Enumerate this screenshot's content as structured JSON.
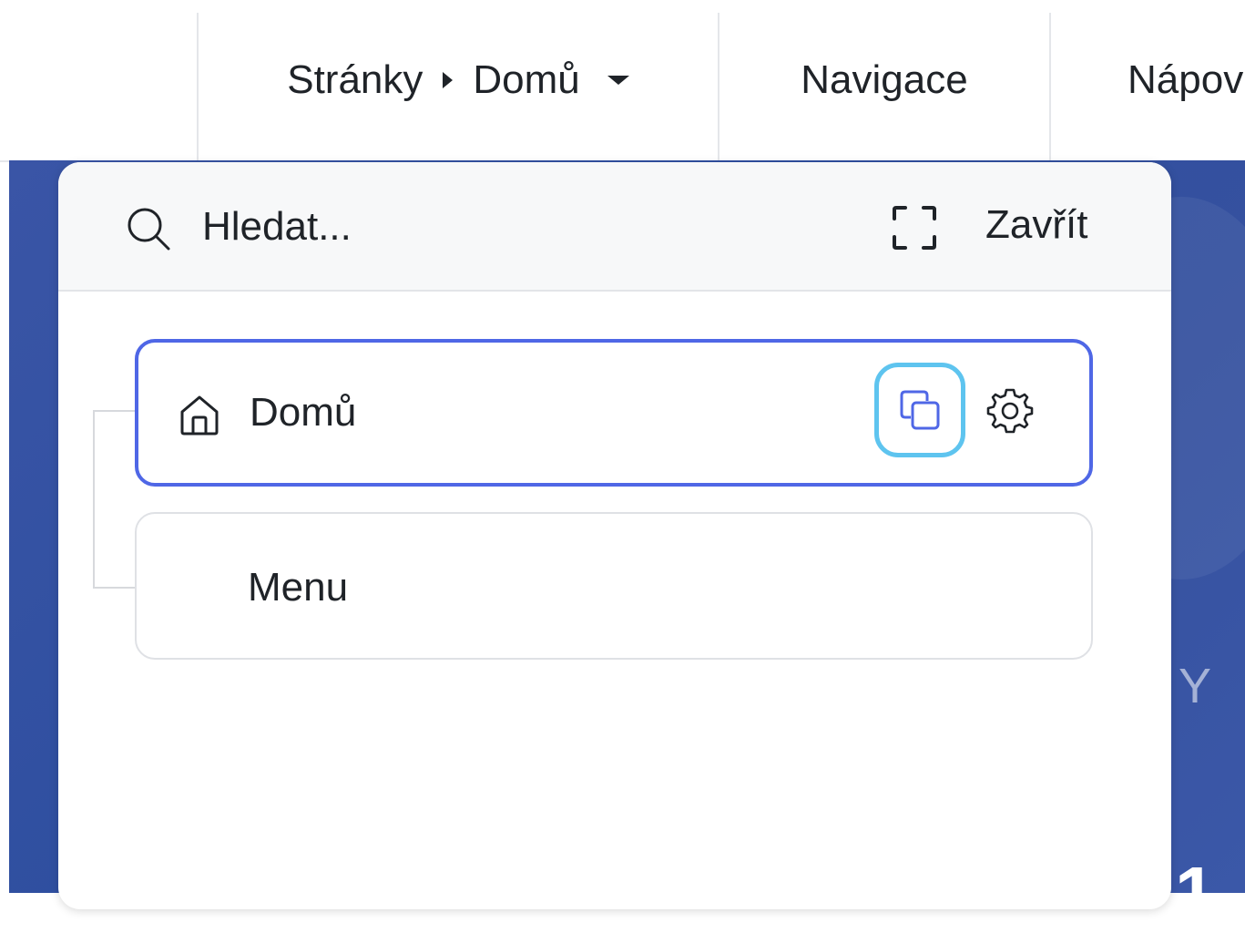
{
  "toolbar": {
    "breadcrumb": {
      "root": "Stránky",
      "current": "Domů"
    },
    "tabs": [
      {
        "label": "Navigace"
      },
      {
        "label": "Nápov"
      }
    ]
  },
  "panel": {
    "search": {
      "placeholder": "Hledat..."
    },
    "close_label": "Zavřít",
    "items": [
      {
        "label": "Domů",
        "icon": "home-icon",
        "selected": true
      },
      {
        "label": "Menu"
      }
    ]
  },
  "background": {
    "glimpse_letters": [
      "Y",
      "1"
    ]
  },
  "colors": {
    "accent": "#4f67e6",
    "focus_ring": "#5ec4ef",
    "page_background": "#3a55a6"
  }
}
